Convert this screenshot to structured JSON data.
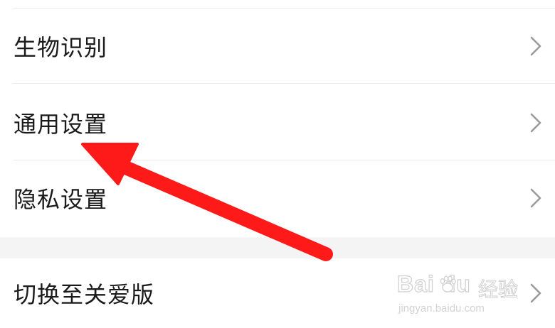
{
  "settings_list": {
    "group_1": [
      {
        "label": "生物识别"
      },
      {
        "label": "通用设置"
      },
      {
        "label": "隐私设置"
      }
    ],
    "group_2": [
      {
        "label": "切换至关爱版"
      }
    ]
  },
  "icons": {
    "row_trailing": "chevron-right-icon",
    "annotation": "red-arrow-icon",
    "watermark_logo": "baidu-paw-icon"
  },
  "annotation": {
    "arrow_color": "#ff1a1a",
    "points_to": "通用设置"
  },
  "watermark": {
    "brand": "Bai du",
    "jingyan": "经验",
    "url": "jingyan.baidu.com"
  },
  "colors": {
    "text": "#1a1a1a",
    "chevron": "#9a9a9a",
    "divider": "#ececec",
    "group_gap": "#f4f4f4"
  }
}
